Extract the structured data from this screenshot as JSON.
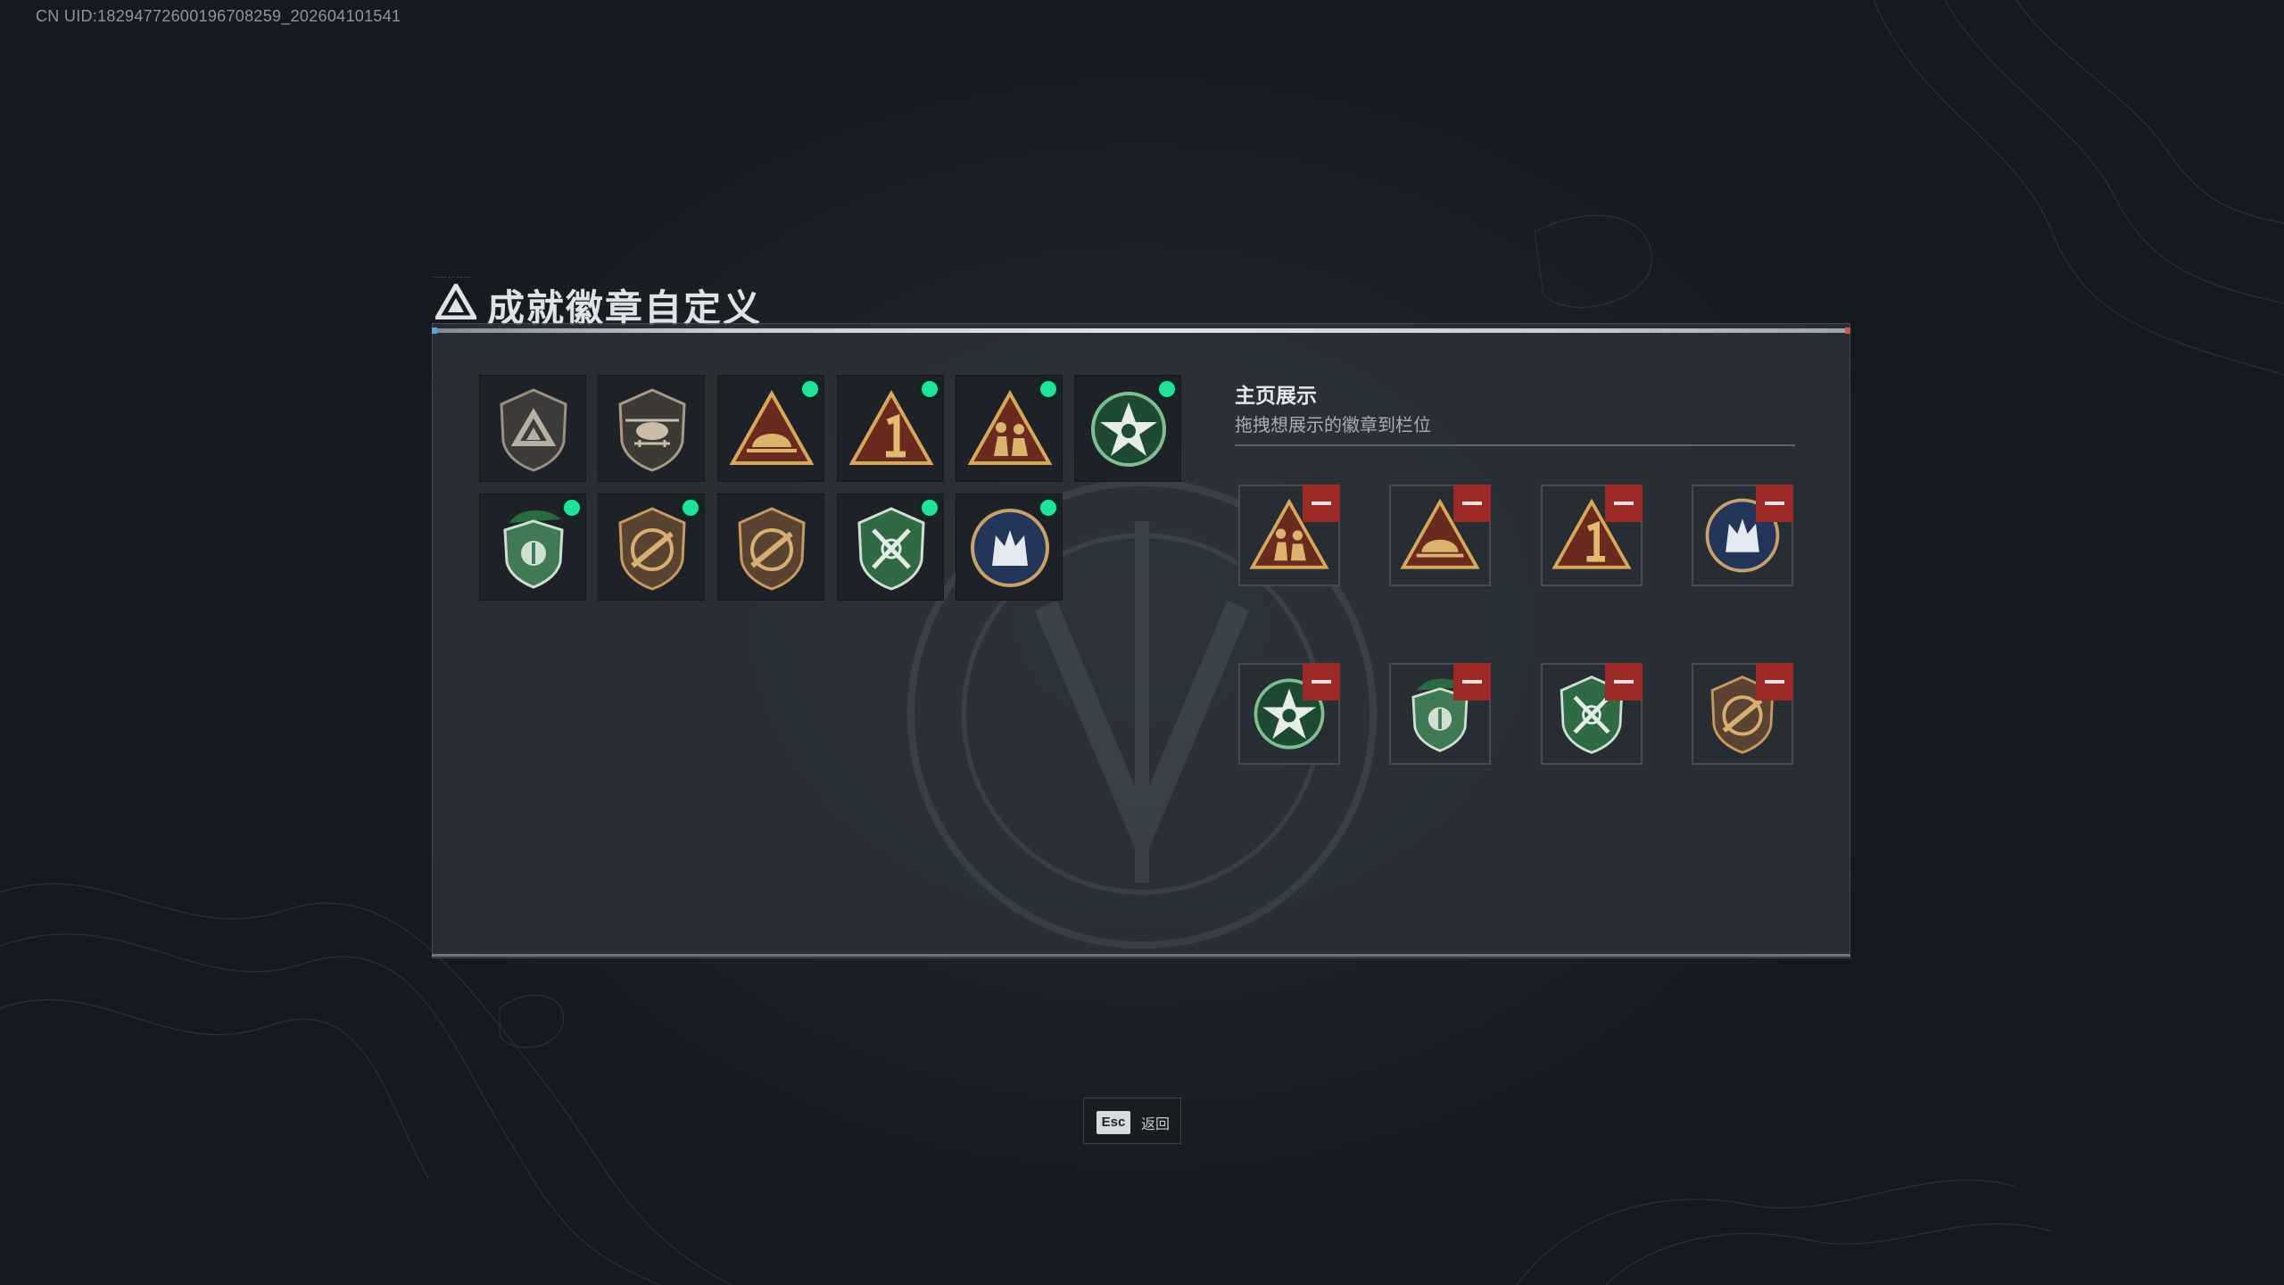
{
  "uid_text": "CN UID:18294772600196708259_202604101541",
  "title": "成就徽章自定义",
  "inventory": [
    {
      "icon": "gray-triangle-shield-badge-icon",
      "new": false
    },
    {
      "icon": "helicopter-shield-badge-icon",
      "new": false
    },
    {
      "icon": "gold-triangle-helmet-badge-icon",
      "new": true
    },
    {
      "icon": "gold-triangle-number-one-badge-icon",
      "new": true
    },
    {
      "icon": "gold-triangle-soldiers-badge-icon",
      "new": true
    },
    {
      "icon": "green-star-wreath-badge-icon",
      "new": true
    },
    {
      "icon": "green-beret-shield-badge-icon",
      "new": true
    },
    {
      "icon": "bronze-rifle-shield-badge-icon",
      "new": true
    },
    {
      "icon": "bronze-rifle-shield-badge-icon",
      "new": false
    },
    {
      "icon": "green-shield-crossed-arrows-badge-icon",
      "new": true
    },
    {
      "icon": "blue-wolf-circle-badge-icon",
      "new": true
    }
  ],
  "showcase": {
    "heading": "主页展示",
    "subtitle": "拖拽想展示的徽章到栏位",
    "slots": [
      "gold-triangle-soldiers-badge-icon",
      "gold-triangle-helmet-badge-icon",
      "gold-triangle-number-one-badge-icon",
      "blue-wolf-circle-badge-icon",
      "green-star-wreath-badge-icon",
      "green-beret-shield-badge-icon",
      "green-shield-crossed-arrows-badge-icon",
      "bronze-rifle-shield-badge-icon"
    ]
  },
  "footer": {
    "esc_key": "Esc",
    "esc_label": "返回"
  },
  "colors": {
    "new_dot": "#20e39a",
    "remove_button": "#9b2a26",
    "accent_blue": "#5aa7d6"
  }
}
